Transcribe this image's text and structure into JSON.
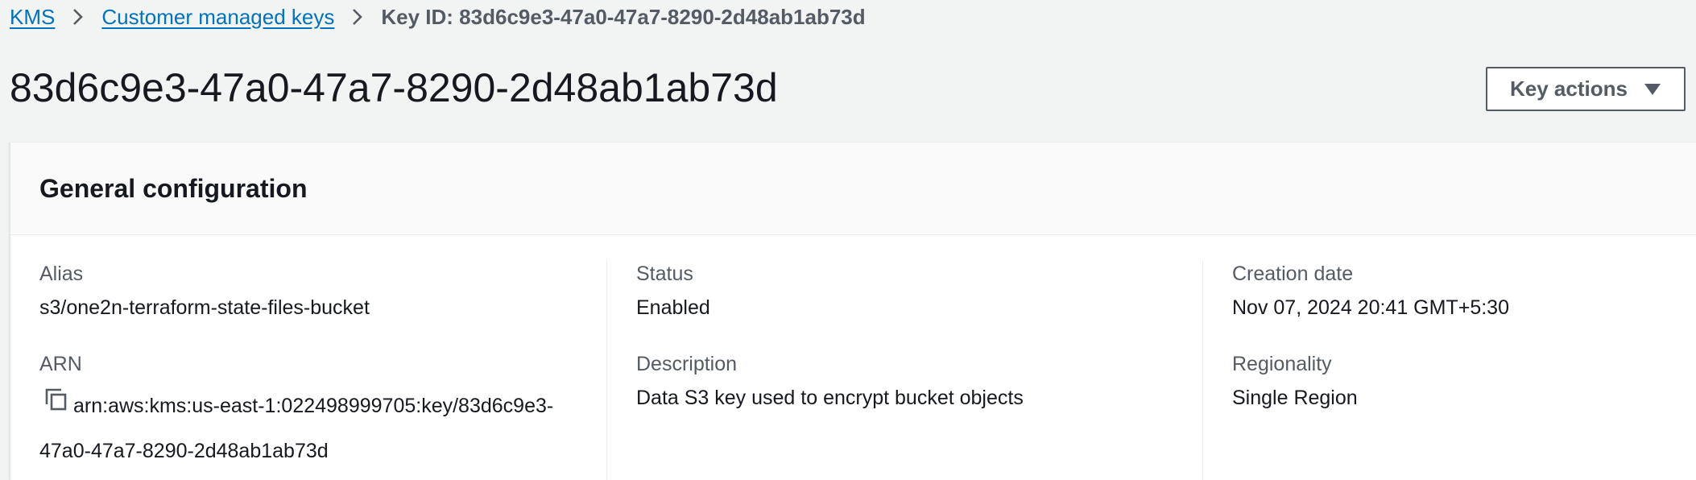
{
  "breadcrumb": {
    "items": [
      {
        "label": "KMS"
      },
      {
        "label": "Customer managed keys"
      }
    ],
    "current": "Key ID: 83d6c9e3-47a0-47a7-8290-2d48ab1ab73d"
  },
  "page": {
    "title": "83d6c9e3-47a0-47a7-8290-2d48ab1ab73d",
    "key_actions_label": "Key actions"
  },
  "general_configuration": {
    "title": "General configuration",
    "alias": {
      "label": "Alias",
      "value": "s3/one2n-terraform-state-files-bucket"
    },
    "arn": {
      "label": "ARN",
      "value": "arn:aws:kms:us-east-1:022498999705:key/83d6c9e3-47a0-47a7-8290-2d48ab1ab73d"
    },
    "status": {
      "label": "Status",
      "value": "Enabled"
    },
    "description": {
      "label": "Description",
      "value": "Data S3 key used to encrypt bucket objects"
    },
    "creation_date": {
      "label": "Creation date",
      "value": "Nov 07, 2024 20:41 GMT+5:30"
    },
    "regionality": {
      "label": "Regionality",
      "value": "Single Region"
    }
  },
  "icons": {
    "breadcrumb_separator": "chevron-right-icon",
    "key_actions_caret": "caret-down-icon",
    "copy": "copy-icon"
  },
  "colors": {
    "link": "#0073bb",
    "background": "#f2f3f3",
    "text": "#16191f",
    "secondary_text": "#545b64"
  }
}
